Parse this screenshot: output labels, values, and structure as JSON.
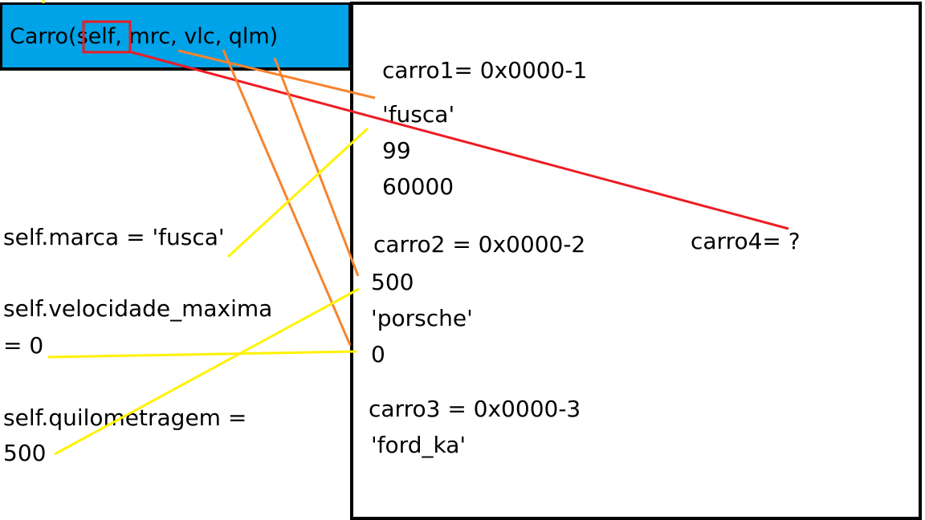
{
  "constructor_signature": "Carro(self, mrc, vlc, qlm)",
  "assignments": {
    "marca": "self.marca = 'fusca'",
    "velocidade_line1": "self.velocidade_maxima",
    "velocidade_line2": "= 0",
    "quilometragem_line1": "self.quilometragem =",
    "quilometragem_line2": "500"
  },
  "memory": {
    "carro1": {
      "label": "carro1= 0x0000-1",
      "values": [
        "'fusca'",
        "99",
        "60000"
      ]
    },
    "carro2": {
      "label": "carro2 =  0x0000-2",
      "values": [
        "500",
        "'porsche'",
        "0"
      ]
    },
    "carro3": {
      "label": "carro3 = 0x0000-3",
      "values": [
        "'ford_ka'"
      ]
    },
    "carro4": {
      "label": "carro4= ?"
    }
  },
  "colors": {
    "header_bg": "#00a2e8",
    "self_highlight": "#ed1c24",
    "param_lines": "#f7842f",
    "assignment_lines": "#fff200"
  }
}
